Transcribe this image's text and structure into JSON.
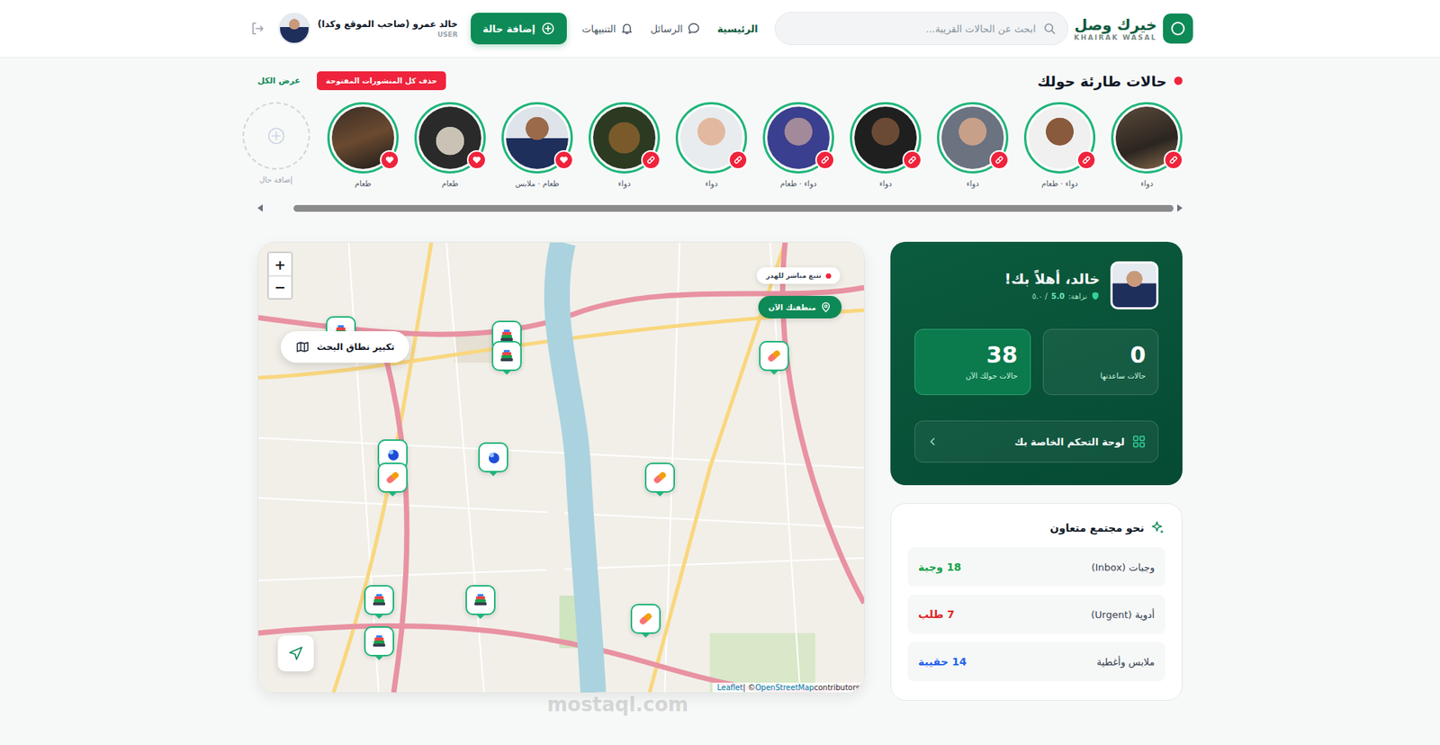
{
  "brand": {
    "title": "خيرك وصل",
    "subtitle": "KHAIRAK WASAL"
  },
  "search": {
    "placeholder": "ابحث عن الحالات القريبة..."
  },
  "nav": [
    {
      "label": "الرئيسية",
      "kind": "link",
      "selected": true
    },
    {
      "label": "الرسائل",
      "kind": "messages",
      "selected": false
    },
    {
      "label": "التنبيهات",
      "kind": "alerts",
      "selected": false
    }
  ],
  "add_button": "إضافة حالة",
  "user": {
    "name": "خالد عمرو (صاحب الموقع وكدا)",
    "role": "USER"
  },
  "stories": {
    "title": "حالات طارئة حولك",
    "delete_button": "حذف كل المنشورات المفتوحة",
    "view_all": "عرض الكل",
    "items": [
      {
        "label": "دواء",
        "kind": "medicine"
      },
      {
        "label": "دواء · طعام",
        "kind": "medicine"
      },
      {
        "label": "دواء",
        "kind": "medicine"
      },
      {
        "label": "دواء",
        "kind": "medicine"
      },
      {
        "label": "دواء · طعام",
        "kind": "medicine"
      },
      {
        "label": "دواء",
        "kind": "medicine"
      },
      {
        "label": "دواء",
        "kind": "medicine"
      },
      {
        "label": "طعام · ملابس",
        "kind": "food"
      },
      {
        "label": "طعام",
        "kind": "food"
      },
      {
        "label": "طعام",
        "kind": "food"
      }
    ],
    "add_label": "إضافة حال",
    "scroll": {
      "level": 0.97
    }
  },
  "map": {
    "zoom_in": "+",
    "zoom_out": "−",
    "expand_button": "تكبير نطاق البحث",
    "live_badge": "تتبع مباشر للهدر",
    "area_button": "منطقتك الآن",
    "attribution": {
      "leaflet": "Leaflet",
      "separator": "| ©",
      "osm": "OpenStreetMap",
      "suffix": "contributors"
    },
    "markers": [
      {
        "kind": "box"
      },
      {
        "kind": "box"
      },
      {
        "kind": "box"
      },
      {
        "kind": "medicine"
      },
      {
        "kind": "dot"
      },
      {
        "kind": "medicine"
      },
      {
        "kind": "dot"
      },
      {
        "kind": "medicine"
      },
      {
        "kind": "box"
      },
      {
        "kind": "box"
      },
      {
        "kind": "box"
      },
      {
        "kind": "medicine"
      }
    ],
    "watermark": "mostaql.com"
  },
  "welcome": {
    "greeting": "خالد، أهلاً بك!",
    "trust_label": "نزاهة:",
    "trust_value": "5.0",
    "trust_max": "/ ٥.٠",
    "stats": [
      {
        "value": "0",
        "label": "حالات ساعدتها",
        "selected": false
      },
      {
        "value": "38",
        "label": "حالات حولك الآن",
        "selected": true
      }
    ],
    "dashboard_button": "لوحة التحكم الخاصة بك"
  },
  "community": {
    "title": "نحو مجتمع متعاون",
    "rows": [
      {
        "label": "وجبات (Inbox)",
        "value": "18 وجبة",
        "color": "#16a34a"
      },
      {
        "label": "أدوية (Urgent)",
        "value": "7 طلب",
        "color": "#dc2626"
      },
      {
        "label": "ملابس وأغطية",
        "value": "14 حقيبة",
        "color": "#2563eb"
      }
    ]
  }
}
